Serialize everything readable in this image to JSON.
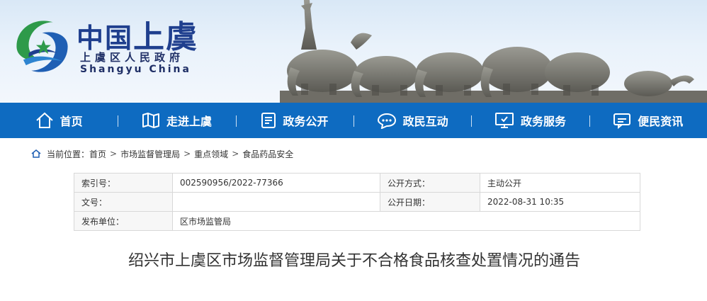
{
  "header": {
    "title_part1": "中国",
    "title_part2": "上虞",
    "subtitle": "上虞区人民政府",
    "subtitle_en": "Shangyu China"
  },
  "nav": {
    "items": [
      {
        "label": "首页",
        "icon": "home-icon"
      },
      {
        "label": "走进上虞",
        "icon": "map-icon"
      },
      {
        "label": "政务公开",
        "icon": "document-icon"
      },
      {
        "label": "政民互动",
        "icon": "chat-icon"
      },
      {
        "label": "政务服务",
        "icon": "monitor-icon"
      },
      {
        "label": "便民资讯",
        "icon": "message-icon"
      }
    ]
  },
  "breadcrumb": {
    "prefix": "当前位置：",
    "items": [
      "首页",
      "市场监督管理局",
      "重点领域",
      "食品药品安全"
    ],
    "separator": ">"
  },
  "meta": {
    "index_label": "索引号：",
    "index_value": "002590956/2022-77366",
    "open_mode_label": "公开方式：",
    "open_mode_value": "主动公开",
    "doc_no_label": "文号：",
    "doc_no_value": "",
    "open_date_label": "公开日期：",
    "open_date_value": "2022-08-31 10:35",
    "publisher_label": "发布单位：",
    "publisher_value": "区市场监管局"
  },
  "article": {
    "title": "绍兴市上虞区市场监督管理局关于不合格食品核查处置情况的通告"
  },
  "colors": {
    "nav_bg": "#0e6bc1",
    "brand_blue": "#1f3f8e",
    "logo_green": "#2e9a4a"
  }
}
